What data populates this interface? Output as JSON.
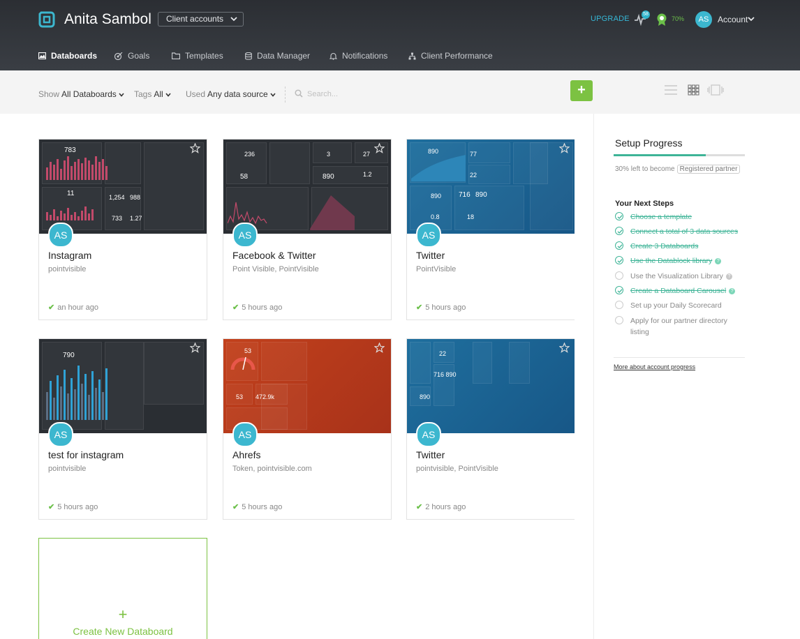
{
  "header": {
    "brand": "Anita Sambol",
    "client_accounts_label": "Client accounts",
    "upgrade_label": "UPGRADE",
    "pulse_badge_count": "58",
    "award_percent": "70%",
    "avatar_initials": "AS",
    "account_label": "Account",
    "accent_color": "#3cb7cf"
  },
  "nav": [
    {
      "label": "Databoards",
      "icon": "image-icon",
      "active": true
    },
    {
      "label": "Goals",
      "icon": "target-icon"
    },
    {
      "label": "Templates",
      "icon": "folder-icon"
    },
    {
      "label": "Data Manager",
      "icon": "database-icon"
    },
    {
      "label": "Notifications",
      "icon": "bell-icon"
    },
    {
      "label": "Client Performance",
      "icon": "org-chart-icon"
    }
  ],
  "filters": {
    "show_label": "Show",
    "show_value": "All Databoards",
    "tags_label": "Tags",
    "tags_value": "All",
    "used_label": "Used",
    "used_value": "Any data source",
    "search_placeholder": "Search..."
  },
  "add_button_label": "+",
  "cards": [
    {
      "title": "Instagram",
      "source": "pointvisible",
      "time": "an hour ago",
      "avatar": "AS",
      "theme": "dark-pink"
    },
    {
      "title": "Facebook & Twitter",
      "source": "Point Visible, PointVisible",
      "time": "5 hours ago",
      "avatar": "AS",
      "theme": "dark-pink"
    },
    {
      "title": "Twitter",
      "source": "PointVisible",
      "time": "5 hours ago",
      "avatar": "AS",
      "theme": "blue"
    },
    {
      "title": "test for instagram",
      "source": "pointvisible",
      "time": "5 hours ago",
      "avatar": "AS",
      "theme": "dark-blue"
    },
    {
      "title": "Ahrefs",
      "source": "Token, pointvisible.com",
      "time": "5 hours ago",
      "avatar": "AS",
      "theme": "orange"
    },
    {
      "title": "Twitter",
      "source": "pointvisible, PointVisible",
      "time": "2 hours ago",
      "avatar": "AS",
      "theme": "blue"
    }
  ],
  "create_card": {
    "plus": "+",
    "label": "Create New Databoard"
  },
  "setup": {
    "title": "Setup Progress",
    "progress": 0.7,
    "progress_text": "30% left to become",
    "badge": "Registered partner",
    "next_steps_title": "Your Next Steps",
    "steps": [
      {
        "label": "Choose a template",
        "done": true
      },
      {
        "label": "Connect a total of 3 data sources",
        "done": true
      },
      {
        "label": "Create 3 Databoards",
        "done": true
      },
      {
        "label": "Use the Datablock library",
        "done": true,
        "help": true
      },
      {
        "label": "Use the Visualization Library",
        "done": false,
        "help": true
      },
      {
        "label": "Create a Databoard Carousel",
        "done": true,
        "help": true
      },
      {
        "label": "Set up your Daily Scorecard",
        "done": false
      },
      {
        "label": "Apply for our partner directory listing",
        "done": false
      }
    ],
    "more_link": "More about account progress"
  }
}
